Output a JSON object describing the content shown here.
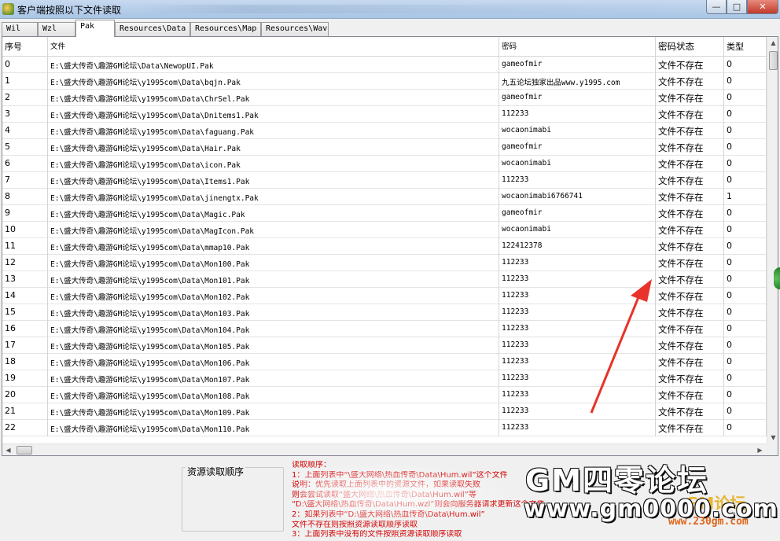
{
  "window": {
    "title": "客户端按照以下文件读取",
    "minimize_label": "—",
    "maximize_label": "□",
    "close_label": "✕"
  },
  "tabs": [
    {
      "label": "Wil"
    },
    {
      "label": "Wzl"
    },
    {
      "label": "Pak",
      "active": true
    },
    {
      "label": "Resources\\Data"
    },
    {
      "label": "Resources\\Map"
    },
    {
      "label": "Resources\\Wav"
    }
  ],
  "table": {
    "columns": [
      "序号",
      "文件",
      "密码",
      "密码状态",
      "类型"
    ],
    "rows": [
      {
        "idx": "0",
        "file": "E:\\盛大传奇\\趣游GM论坛\\Data\\NewopUI.Pak",
        "password": "gameofmir",
        "status": "文件不存在",
        "type": "0"
      },
      {
        "idx": "1",
        "file": "E:\\盛大传奇\\趣游GM论坛\\y1995com\\Data\\bqjn.Pak",
        "password": "九五论坛独家出品www.y1995.com",
        "status": "文件不存在",
        "type": "0"
      },
      {
        "idx": "2",
        "file": "E:\\盛大传奇\\趣游GM论坛\\y1995com\\Data\\ChrSel.Pak",
        "password": "gameofmir",
        "status": "文件不存在",
        "type": "0"
      },
      {
        "idx": "3",
        "file": "E:\\盛大传奇\\趣游GM论坛\\y1995com\\Data\\Dnitems1.Pak",
        "password": "112233",
        "status": "文件不存在",
        "type": "0"
      },
      {
        "idx": "4",
        "file": "E:\\盛大传奇\\趣游GM论坛\\y1995com\\Data\\faguang.Pak",
        "password": "wocaonimabi",
        "status": "文件不存在",
        "type": "0"
      },
      {
        "idx": "5",
        "file": "E:\\盛大传奇\\趣游GM论坛\\y1995com\\Data\\Hair.Pak",
        "password": "gameofmir",
        "status": "文件不存在",
        "type": "0"
      },
      {
        "idx": "6",
        "file": "E:\\盛大传奇\\趣游GM论坛\\y1995com\\Data\\icon.Pak",
        "password": "wocaonimabi",
        "status": "文件不存在",
        "type": "0"
      },
      {
        "idx": "7",
        "file": "E:\\盛大传奇\\趣游GM论坛\\y1995com\\Data\\Items1.Pak",
        "password": "112233",
        "status": "文件不存在",
        "type": "0"
      },
      {
        "idx": "8",
        "file": "E:\\盛大传奇\\趣游GM论坛\\y1995com\\Data\\jinengtx.Pak",
        "password": "wocaonimabi6766741",
        "status": "文件不存在",
        "type": "1"
      },
      {
        "idx": "9",
        "file": "E:\\盛大传奇\\趣游GM论坛\\y1995com\\Data\\Magic.Pak",
        "password": "gameofmir",
        "status": "文件不存在",
        "type": "0"
      },
      {
        "idx": "10",
        "file": "E:\\盛大传奇\\趣游GM论坛\\y1995com\\Data\\MagIcon.Pak",
        "password": "wocaonimabi",
        "status": "文件不存在",
        "type": "0"
      },
      {
        "idx": "11",
        "file": "E:\\盛大传奇\\趣游GM论坛\\y1995com\\Data\\mmap10.Pak",
        "password": "122412378",
        "status": "文件不存在",
        "type": "0"
      },
      {
        "idx": "12",
        "file": "E:\\盛大传奇\\趣游GM论坛\\y1995com\\Data\\Mon100.Pak",
        "password": "112233",
        "status": "文件不存在",
        "type": "0"
      },
      {
        "idx": "13",
        "file": "E:\\盛大传奇\\趣游GM论坛\\y1995com\\Data\\Mon101.Pak",
        "password": "112233",
        "status": "文件不存在",
        "type": "0"
      },
      {
        "idx": "14",
        "file": "E:\\盛大传奇\\趣游GM论坛\\y1995com\\Data\\Mon102.Pak",
        "password": "112233",
        "status": "文件不存在",
        "type": "0"
      },
      {
        "idx": "15",
        "file": "E:\\盛大传奇\\趣游GM论坛\\y1995com\\Data\\Mon103.Pak",
        "password": "112233",
        "status": "文件不存在",
        "type": "0"
      },
      {
        "idx": "16",
        "file": "E:\\盛大传奇\\趣游GM论坛\\y1995com\\Data\\Mon104.Pak",
        "password": "112233",
        "status": "文件不存在",
        "type": "0"
      },
      {
        "idx": "17",
        "file": "E:\\盛大传奇\\趣游GM论坛\\y1995com\\Data\\Mon105.Pak",
        "password": "112233",
        "status": "文件不存在",
        "type": "0"
      },
      {
        "idx": "18",
        "file": "E:\\盛大传奇\\趣游GM论坛\\y1995com\\Data\\Mon106.Pak",
        "password": "112233",
        "status": "文件不存在",
        "type": "0"
      },
      {
        "idx": "19",
        "file": "E:\\盛大传奇\\趣游GM论坛\\y1995com\\Data\\Mon107.Pak",
        "password": "112233",
        "status": "文件不存在",
        "type": "0"
      },
      {
        "idx": "20",
        "file": "E:\\盛大传奇\\趣游GM论坛\\y1995com\\Data\\Mon108.Pak",
        "password": "112233",
        "status": "文件不存在",
        "type": "0"
      },
      {
        "idx": "21",
        "file": "E:\\盛大传奇\\趣游GM论坛\\y1995com\\Data\\Mon109.Pak",
        "password": "112233",
        "status": "文件不存在",
        "type": "0"
      },
      {
        "idx": "22",
        "file": "E:\\盛大传奇\\趣游GM论坛\\y1995com\\Data\\Mon110.Pak",
        "password": "112233",
        "status": "文件不存在",
        "type": "0"
      }
    ]
  },
  "bottom": {
    "group_title": "资源读取顺序",
    "notes": [
      "读取顺序：",
      "1：上面列表中“\\盛大网络\\热血传奇\\Data\\Hum.wil”这个文件",
      "   说明：优先读取上面列表中的资源文件，如果读取失败",
      "   则会尝试读取“盛大网络\\热血传奇\\Data\\Hum.wil”等",
      "   “D:\\盛大网络\\热血传奇\\Data\\Hum.wzl”则会向服务器请求更新这个文件",
      "2：如果列表中“D:\\盛大网络\\热血传奇\\Data\\Hum.wil”",
      "   文件不存在则按照资源读取顺序读取",
      "3：上面列表中没有的文件按照资源读取顺序读取"
    ]
  },
  "watermark": {
    "title": "GM四零论坛",
    "url": "www.gm0000.com",
    "brand": "GM论坛",
    "sub": "www.230gm.com"
  },
  "annotation": {
    "arrow_color": "#e8322a"
  }
}
